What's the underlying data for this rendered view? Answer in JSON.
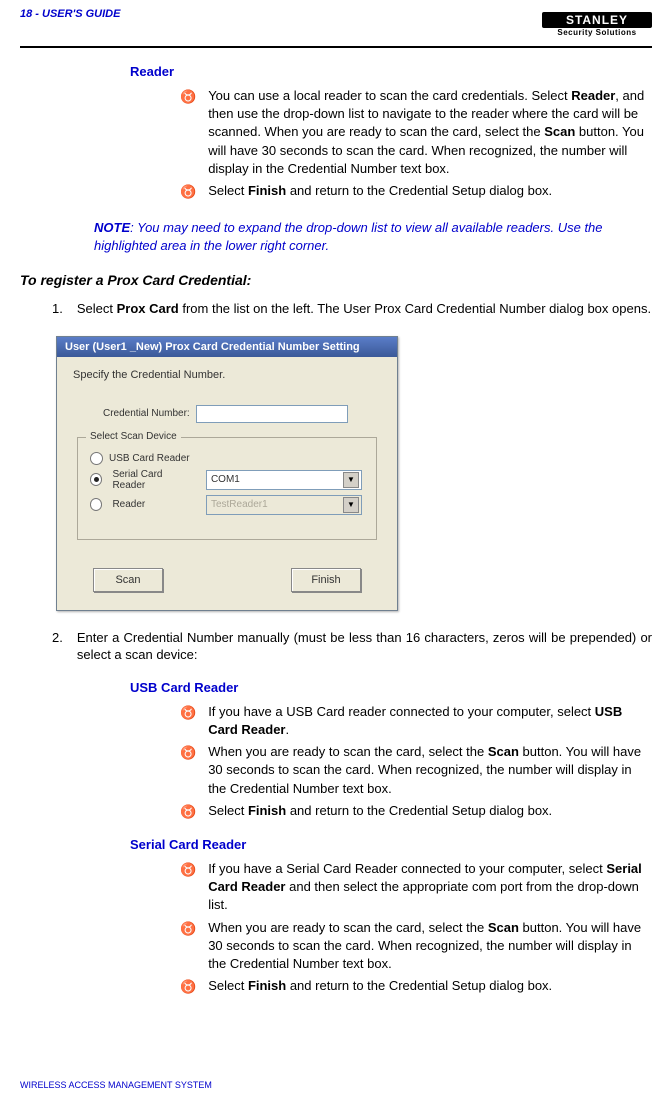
{
  "header": {
    "page": "18 - USER'S GUIDE",
    "logo_top": "STANLEY",
    "logo_bottom": "Security Solutions"
  },
  "sec1": {
    "title": "Reader",
    "b1a": "You can use a local reader to scan the card credentials.   Select ",
    "b1b": "Reader",
    "b1c": ", and then use the drop-down list to navigate to the reader where the card will be scanned.   When you are ready to scan the card, select the ",
    "b1d": "Scan",
    "b1e": " button.   You will have 30 seconds to scan the card.   When recognized, the number will display in the Credential Number text box.",
    "b2a": "Select ",
    "b2b": "Finish",
    "b2c": " and return to the Credential Setup dialog box."
  },
  "note": {
    "label": "NOTE",
    "sep": ":   ",
    "text": "You may need to expand the drop-down list to view all available readers.   Use the highlighted area in the lower right corner."
  },
  "sub": {
    "title": "To register a Prox Card Credential:"
  },
  "step1": {
    "num": "1.",
    "a": "Select ",
    "b": "Prox Card",
    "c": " from the list on the left.   The User Prox Card Credential Number dialog box opens."
  },
  "dialog": {
    "title": "User (User1 _New) Prox Card Credential Number Setting",
    "instr": "Specify the Credential Number.",
    "cred_label": "Credential Number:",
    "legend": "Select Scan Device",
    "opt_usb": "USB Card Reader",
    "opt_serial": "Serial Card Reader",
    "opt_reader": "Reader",
    "serial_value": "COM1",
    "reader_value": "TestReader1",
    "btn_scan": "Scan",
    "btn_finish": "Finish"
  },
  "step2": {
    "num": "2.",
    "text": "Enter a Credential Number manually (must be less than 16 characters, zeros will be prepended) or select a scan device:"
  },
  "usb": {
    "title": "USB Card Reader",
    "b1a": "If you have a USB Card reader connected to your computer, select ",
    "b1b": "USB Card Reader",
    "b1c": ".",
    "b2a": "When you are ready to scan the card, select the ",
    "b2b": "Scan",
    "b2c": " button.   You will have 30 seconds to scan the card.   When recognized, the number will display in the Credential Number text box.",
    "b3a": "Select ",
    "b3b": "Finish",
    "b3c": " and return to the Credential Setup dialog box."
  },
  "serial": {
    "title": "Serial Card Reader",
    "b1a": "If you have a Serial Card Reader connected to your computer, select ",
    "b1b": "Serial Card Reader",
    "b1c": " and then select the appropriate com port from the drop-down list.",
    "b2a": "When you are ready to scan the card, select the ",
    "b2b": "Scan",
    "b2c": " button.   You will have 30 seconds to scan the card. When recognized, the number will display in the Credential Number text box.",
    "b3a": "Select ",
    "b3b": "Finish",
    "b3c": " and return to the Credential Setup dialog box."
  },
  "footer": "WIRELESS ACCESS MANAGEMENT SYSTEM",
  "glyph": {
    "bullet": "♉",
    "arrow": "▼"
  }
}
